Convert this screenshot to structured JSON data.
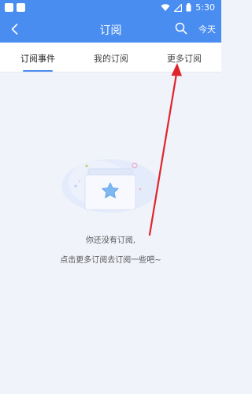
{
  "status_bar": {
    "time": "5:30"
  },
  "header": {
    "title": "订阅",
    "today_label": "今天"
  },
  "tabs": [
    {
      "label": "订阅事件"
    },
    {
      "label": "我的订阅"
    },
    {
      "label": "更多订阅"
    }
  ],
  "empty_state": {
    "line1": "你还没有订阅,",
    "line2": "点击更多订阅去订阅一些吧~"
  },
  "colors": {
    "accent": "#4a8df0",
    "annotation": "#e0242b",
    "background": "#f1f3fa"
  },
  "icons": [
    "back-icon",
    "search-icon",
    "wifi-icon",
    "signal-icon",
    "battery-icon",
    "star-icon"
  ]
}
